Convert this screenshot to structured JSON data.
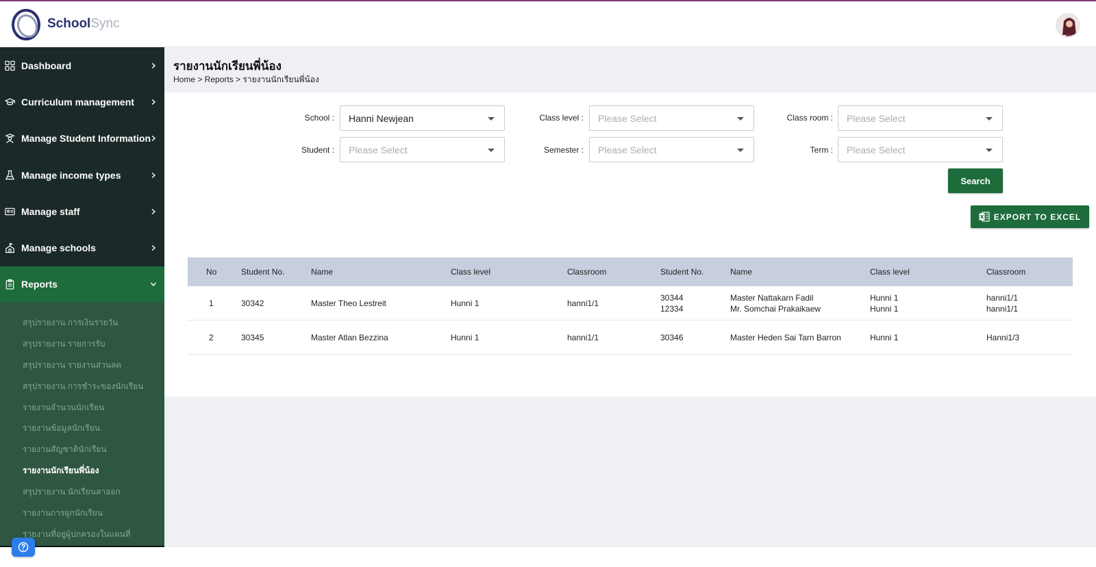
{
  "app": {
    "brand_part1": "School",
    "brand_part2": "Sync"
  },
  "sidebar": {
    "items": [
      {
        "label": "Dashboard",
        "icon": "grid-icon"
      },
      {
        "label": "Curriculum management",
        "icon": "graduation-cap-icon"
      },
      {
        "label": "Manage Student Information",
        "icon": "student-icon"
      },
      {
        "label": "Manage income types",
        "icon": "flask-icon"
      },
      {
        "label": "Manage staff",
        "icon": "id-card-icon"
      },
      {
        "label": "Manage schools",
        "icon": "school-building-icon"
      },
      {
        "label": "Reports",
        "icon": "clipboard-icon",
        "active": true
      }
    ],
    "report_subitems": [
      "สรุปรายงาน การเงินรายวัน",
      "สรุปรายงาน รายการรับ",
      "สรุปรายงาน รายงานส่วนลด",
      "สรุปรายงาน การชำระของนักเรียน",
      "รายงานจำนวนนักเรียน",
      "รายงานข้อมูลนักเรียน",
      "รายงานสัญชาตินักเรียน",
      "รายงานนักเรียนพี่น้อง",
      "สรุปรายงาน นักเรียนลาออก",
      "รายงานการผูกนักเรียน",
      "รายงานที่อยู่ผู้ปกครองในแผนที่"
    ],
    "current_subitem_index": 7
  },
  "page": {
    "title": "รายงานนักเรียนพี่น้อง",
    "breadcrumb": "Home > Reports > รายงานนักเรียนพี่น้อง"
  },
  "filters": {
    "school": {
      "label": "School :",
      "value": "Hanni Newjean"
    },
    "class_level": {
      "label": "Class level :",
      "placeholder": "Please Select"
    },
    "class_room": {
      "label": "Class room :",
      "placeholder": "Please Select"
    },
    "student": {
      "label": "Student :",
      "placeholder": "Please Select"
    },
    "semester": {
      "label": "Semester :",
      "placeholder": "Please Select"
    },
    "term": {
      "label": "Term :",
      "placeholder": "Please Select"
    },
    "search_label": "Search",
    "export_label": "EXPORT TO EXCEL"
  },
  "table": {
    "headers": [
      "No",
      "Student No.",
      "Name",
      "Class level",
      "Classroom",
      "Student No.",
      "Name",
      "Class level",
      "Classroom"
    ],
    "rows": [
      {
        "no": "1",
        "student_no": "30342",
        "name": "Master Theo Lestreit",
        "class_level": "Hunni 1",
        "classroom": "hanni1/1",
        "siblings": [
          {
            "student_no": "30344",
            "name": "Master Nattakarn Fadil",
            "class_level": "Hunni 1",
            "classroom": "hanni1/1"
          },
          {
            "student_no": "12334",
            "name": "Mr. Somchai Prakaikaew",
            "class_level": "Hunni 1",
            "classroom": "hanni1/1"
          }
        ]
      },
      {
        "no": "2",
        "student_no": "30345",
        "name": "Master Atlan Bezzina",
        "class_level": "Hunni 1",
        "classroom": "hanni1/1",
        "siblings": [
          {
            "student_no": "30346",
            "name": "Master Heden Sai Tarn Barron",
            "class_level": "Hunni 1",
            "classroom": "Hanni1/3"
          }
        ]
      }
    ]
  },
  "colors": {
    "accent": "#1e6b3b",
    "sidebar_bg": "#1b2a28",
    "submenu_bg": "#2f5640",
    "table_header": "#c7cedd"
  }
}
